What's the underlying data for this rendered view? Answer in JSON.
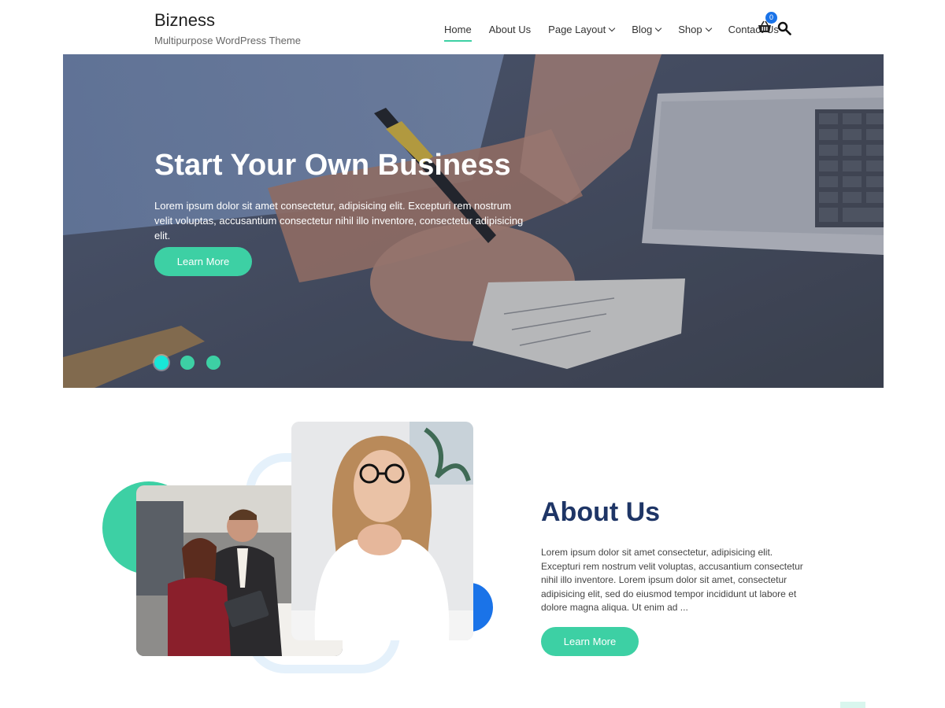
{
  "site": {
    "title": "Bizness",
    "tagline": "Multipurpose WordPress Theme"
  },
  "nav": {
    "items": [
      {
        "label": "Home",
        "active": true,
        "dropdown": false
      },
      {
        "label": "About Us",
        "active": false,
        "dropdown": false
      },
      {
        "label": "Page Layout",
        "active": false,
        "dropdown": true
      },
      {
        "label": "Blog",
        "active": false,
        "dropdown": true
      },
      {
        "label": "Shop",
        "active": false,
        "dropdown": true
      },
      {
        "label": "Contact Us",
        "active": false,
        "dropdown": false
      }
    ],
    "cart_count": "0",
    "cart_icon": "basket-icon",
    "search_icon": "search-icon"
  },
  "hero": {
    "title": "Start Your Own Business",
    "text": "Lorem ipsum dolor sit amet consectetur, adipisicing elit. Excepturi rem nostrum velit voluptas, accusantium consectetur nihil illo inventore, consectetur adipisicing elit.",
    "button": "Learn More",
    "slides": 3,
    "active_slide": 1
  },
  "about": {
    "title": "About Us",
    "text": "Lorem ipsum dolor sit amet consectetur, adipisicing elit. Excepturi rem nostrum velit voluptas, accusantium consectetur nihil illo inventore. Lorem ipsum dolor sit amet, consectetur adipisicing elit, sed do eiusmod tempor incididunt ut labore et dolore magna aliqua. Ut enim ad ...",
    "button": "Learn More"
  },
  "colors": {
    "accent": "#3dd0a4",
    "heading": "#1e3566",
    "badge": "#1a73e8",
    "active_dot": "#19e6d8"
  }
}
